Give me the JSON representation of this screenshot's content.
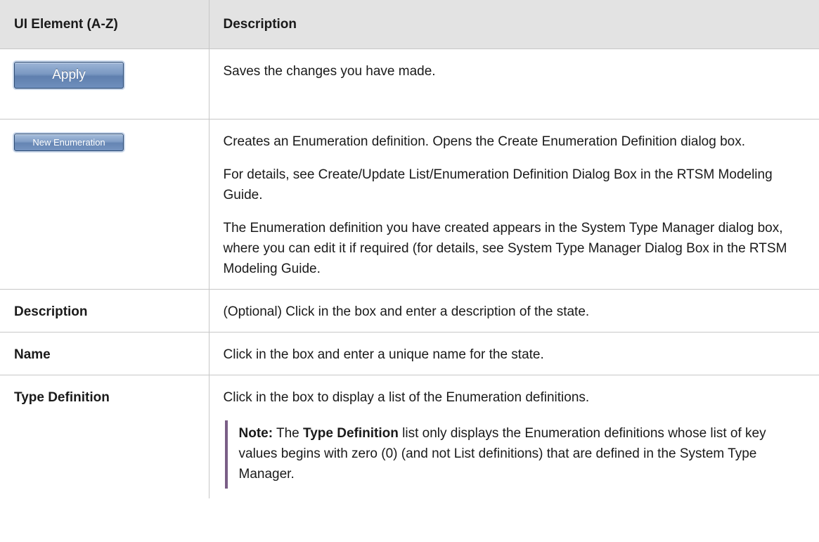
{
  "header": {
    "col1": "UI Element (A-Z)",
    "col2": "Description"
  },
  "rows": {
    "apply": {
      "button_label": "Apply",
      "description": "Saves the changes you have made."
    },
    "new_enumeration": {
      "button_label": "New Enumeration",
      "p1": "Creates an Enumeration definition. Opens the Create Enumeration Definition dialog box.",
      "p2": "For details, see Create/Update List/Enumeration Definition Dialog Box in the RTSM Modeling Guide.",
      "p3": "The Enumeration definition you have created appears in the System Type Manager dialog box, where you can edit it if required (for details, see System Type Manager Dialog Box in the RTSM Modeling Guide."
    },
    "description": {
      "label": "Description",
      "text": "(Optional) Click in the box and enter a description of the state."
    },
    "name": {
      "label": "Name",
      "text": "Click in the box and enter a unique name for the state."
    },
    "type_definition": {
      "label": "Type Definition",
      "text": "Click in the box to display a list of the Enumeration definitions.",
      "note": {
        "prefix": "Note:",
        "pre": " The ",
        "bold": "Type Definition",
        "post": " list only displays the Enumeration definitions whose list of key values begins with zero (0) (and not List definitions) that are defined in the System Type Manager."
      }
    }
  },
  "colors": {
    "header_bg": "#e3e3e3",
    "border": "#c7c7c7",
    "note_bar": "#7a5e86",
    "button_blue": "#6f8fbd"
  }
}
